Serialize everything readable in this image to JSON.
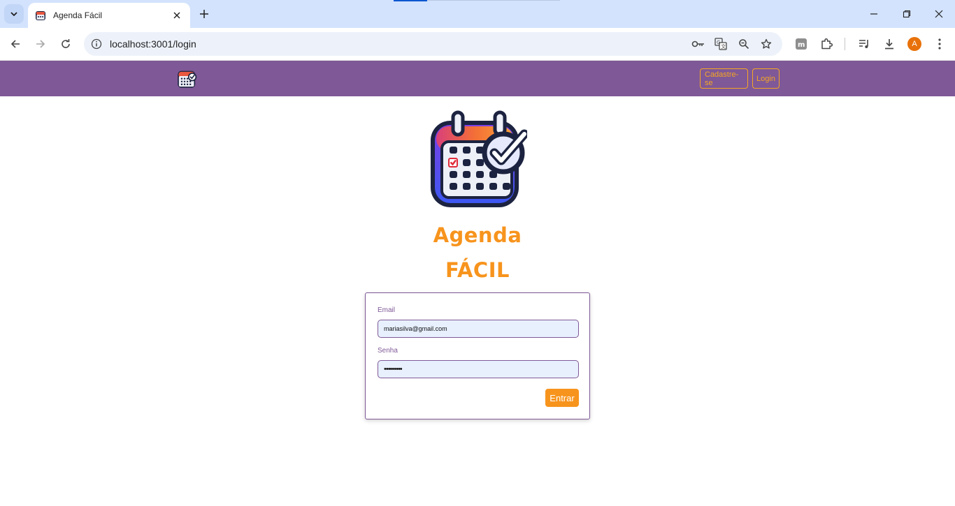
{
  "browser": {
    "tab_title": "Agenda Fácil",
    "url": "localhost:3001/login",
    "profile_initial": "A",
    "icons": [
      "tab-search-icon",
      "close-icon",
      "new-tab-icon",
      "minimize-icon",
      "restore-icon",
      "window-close-icon",
      "back-icon",
      "forward-icon",
      "reload-icon",
      "site-info-icon",
      "password-key-icon",
      "translate-icon",
      "zoom-icon",
      "bookmark-star-icon",
      "extension-m-icon",
      "extensions-puzzle-icon",
      "media-queue-icon",
      "download-icon",
      "menu-kebab-icon"
    ]
  },
  "navbar": {
    "links": [
      {
        "label": "Cadastre-se"
      },
      {
        "label": "Login"
      }
    ],
    "background": "#7f5897",
    "accent": "#f5a623"
  },
  "brand": {
    "line1": "Agenda",
    "line2": "FÁCIL",
    "color": "#f7941d"
  },
  "login_form": {
    "email_label": "Email",
    "email_value": "mariasilva@gmail.com",
    "password_label": "Senha",
    "password_value": "•••••••••",
    "submit_label": "Entrar"
  }
}
